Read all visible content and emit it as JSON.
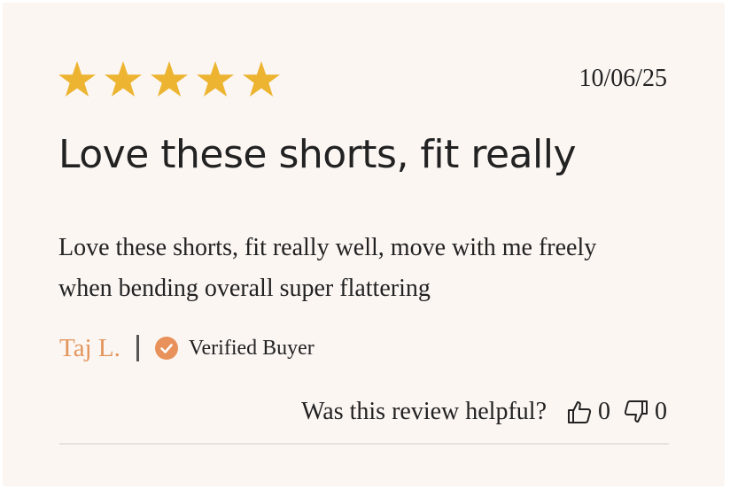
{
  "review": {
    "rating": 5,
    "rating_max": 5,
    "date": "10/06/25",
    "title": "Love these shorts, fit really",
    "body": "Love these shorts, fit really well, move with me freely when bending overall super flattering",
    "author": "Taj L.",
    "verified_label": "Verified Buyer"
  },
  "helpful": {
    "question": "Was this review helpful?",
    "up_count": "0",
    "down_count": "0"
  },
  "colors": {
    "star": "#ecb430",
    "author": "#e2955c",
    "verified_badge": "#e8915a",
    "text": "#222222",
    "background": "#fcf6f3"
  },
  "icons": {
    "star": "star-icon",
    "verified": "check-circle-icon",
    "thumbs_up": "thumbs-up-icon",
    "thumbs_down": "thumbs-down-icon"
  }
}
